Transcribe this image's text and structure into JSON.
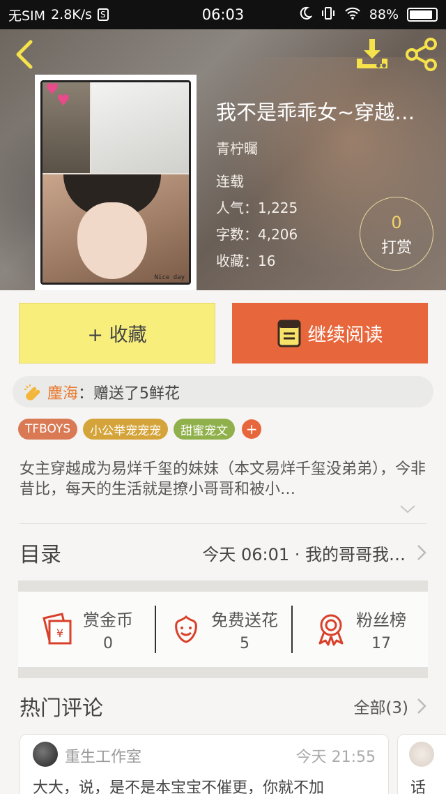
{
  "status_bar": {
    "carrier": "无SIM",
    "speed": "2.8K/s",
    "sim_badge": "S",
    "time": "06:03",
    "battery": "88%",
    "battery_level": 0.88
  },
  "book": {
    "title": "我不是乖乖女~穿越…",
    "author": "青柠曯",
    "status": "连载",
    "popularity_label": "人气：",
    "popularity": "1,225",
    "words_label": "字数：",
    "words": "4,206",
    "collect_label": "收藏：",
    "collect": "16",
    "cover_caption": "Nice day",
    "tip_count": "0",
    "tip_label": "打赏"
  },
  "actions": {
    "favorite_label": "+ 收藏",
    "read_label": "继续阅读"
  },
  "gift": {
    "user": "麈海",
    "text": "：赠送了5鲜花"
  },
  "tags": [
    {
      "label": "TFBOYS",
      "color": "#d97a55"
    },
    {
      "label": "小公举宠宠宠",
      "color": "#d4a43a"
    },
    {
      "label": "甜蜜宠文",
      "color": "#8fb04a"
    }
  ],
  "tag_add": "+",
  "description": "女主穿越成为易烊千玺的妹妹（本文易烊千玺没弟弟），今非昔比，每天的生活就是撩小哥哥和被小…",
  "toc": {
    "label": "目录",
    "latest": "今天 06:01 · 我的哥哥我…"
  },
  "stats": [
    {
      "name": "赏金币",
      "value": "0",
      "icon": "red-envelope-icon"
    },
    {
      "name": "免费送花",
      "value": "5",
      "icon": "flower-icon"
    },
    {
      "name": "粉丝榜",
      "value": "17",
      "icon": "medal-icon"
    }
  ],
  "comments": {
    "title": "热门评论",
    "all_label": "全部(3)",
    "items": [
      {
        "user": "重生工作室",
        "time": "今天 21:55",
        "body": "大大，说，是不是本宝宝不催更，你就不加"
      },
      {
        "user": "",
        "time": "",
        "body": "话"
      }
    ]
  },
  "colors": {
    "accent_orange": "#e8663c",
    "fav_yellow": "#f8ee7c",
    "gift_orange": "#e8792f"
  }
}
